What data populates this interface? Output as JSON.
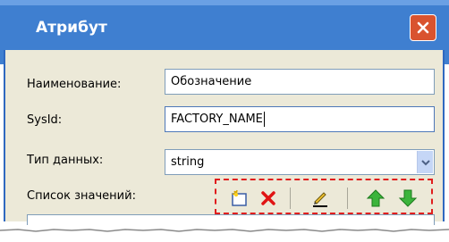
{
  "window": {
    "title": "Атрибут",
    "close_icon": "close-icon"
  },
  "form": {
    "name_label": "Наименование:",
    "name_value": "Обозначение",
    "sysid_label": "SysId:",
    "sysid_value": "FACTORY_NAME",
    "datatype_label": "Тип данных:",
    "datatype_value": "string",
    "values_label": "Список значений:"
  },
  "toolbar": {
    "buttons": [
      "new-item-icon",
      "delete-icon",
      "edit-pencil-icon",
      "move-up-icon",
      "move-down-icon"
    ]
  },
  "colors": {
    "titlebar": "#3f7fd0",
    "dialog_bg": "#ece9d8",
    "highlight_border": "#e01e1e",
    "close_button": "#d9532f"
  }
}
